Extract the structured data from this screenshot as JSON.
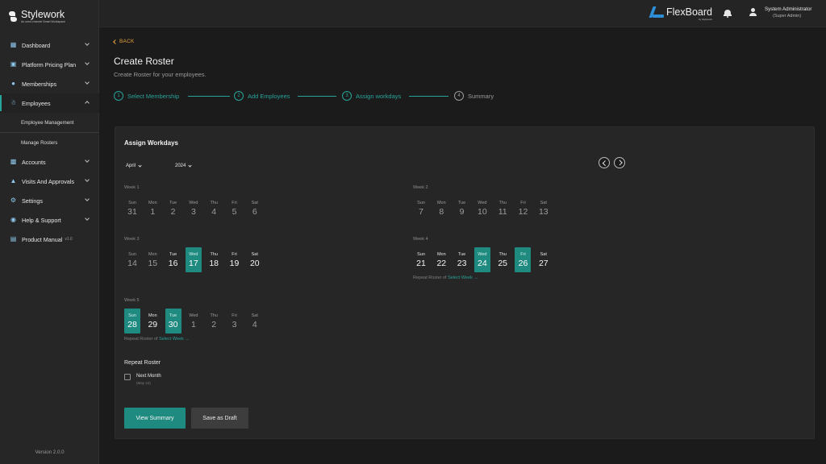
{
  "brand": {
    "name": "Stylework",
    "tagline": "An omni-channel Smart Workspace"
  },
  "sidebar": {
    "items": [
      {
        "label": "Dashboard",
        "icon": "dashboard-icon"
      },
      {
        "label": "Platform Pricing Plan",
        "icon": "pricing-icon"
      },
      {
        "label": "Memberships",
        "icon": "membership-icon"
      },
      {
        "label": "Employees",
        "icon": "employees-icon"
      },
      {
        "label": "Accounts",
        "icon": "accounts-icon"
      },
      {
        "label": "Visits And Approvals",
        "icon": "visits-icon"
      },
      {
        "label": "Settings",
        "icon": "gear-icon"
      },
      {
        "label": "Help & Support",
        "icon": "help-icon"
      },
      {
        "label": "Product Manual",
        "icon": "manual-icon",
        "version": "v1.0"
      }
    ],
    "sub_items": [
      "Employee Management",
      "Manage Rosters"
    ],
    "version": "Version 2.0.0"
  },
  "header": {
    "product": "FlexBoard",
    "product_by": "by Stylework",
    "user_name": "System Administrator",
    "user_role": "(Super Admin)"
  },
  "page": {
    "back": "BACK",
    "title": "Create Roster",
    "subtitle": "Create Roster for your employees."
  },
  "steps": [
    {
      "num": "1",
      "label": "Select Membership"
    },
    {
      "num": "2",
      "label": "Add Employees"
    },
    {
      "num": "3",
      "label": "Assign workdays"
    },
    {
      "num": "4",
      "label": "Summary"
    }
  ],
  "card": {
    "title": "Assign Workdays",
    "month": "April",
    "year": "2024",
    "day_names": [
      "Sun",
      "Mon",
      "Tue",
      "Wed",
      "Thu",
      "Fri",
      "Sat"
    ],
    "repeat_prefix": "Repeat Roster of",
    "repeat_link": "Select Week →",
    "weeks": [
      {
        "title": "Week 1",
        "days": [
          "31",
          "1",
          "2",
          "3",
          "4",
          "5",
          "6"
        ]
      },
      {
        "title": "Week 2",
        "days": [
          "7",
          "8",
          "9",
          "10",
          "11",
          "12",
          "13"
        ]
      },
      {
        "title": "Week 3",
        "days": [
          "14",
          "15",
          "16",
          "17",
          "18",
          "19",
          "20"
        ]
      },
      {
        "title": "Week 4",
        "days": [
          "21",
          "22",
          "23",
          "24",
          "25",
          "26",
          "27"
        ]
      },
      {
        "title": "Week 5",
        "days": [
          "28",
          "29",
          "30",
          "1",
          "2",
          "3",
          "4"
        ]
      }
    ],
    "repeat_roster_title": "Repeat Roster",
    "next_month_label": "Next Month",
    "next_month_sub": "(May 24)",
    "view_summary": "View Summary",
    "save_draft": "Save as Draft"
  },
  "colors": {
    "accent": "#28a399",
    "selected": "#1f8a80",
    "back_link": "#e8a33d",
    "background": "#1b1b1b",
    "card": "#262626"
  }
}
